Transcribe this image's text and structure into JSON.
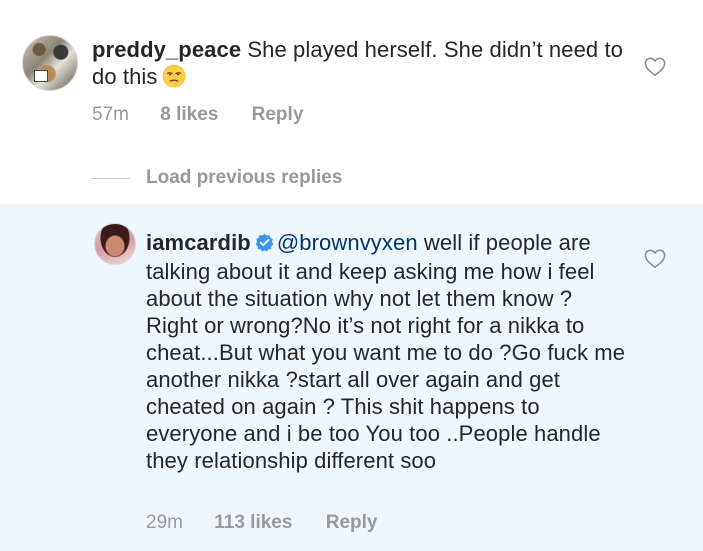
{
  "comments": [
    {
      "username": "preddy_peace",
      "text": " She played herself.  She didn’t need to do this",
      "emoji": "unamused-face",
      "time": "57m",
      "likes": "8 likes",
      "reply": "Reply"
    }
  ],
  "load_previous": "Load previous replies",
  "reply": {
    "username": "iamcardib",
    "verified_icon": "verified-badge-icon",
    "mention": "@brownvyxen",
    "text": " well if people are talking about it and keep asking me how i feel about the situation why not let them know ? Right or wrong?No it’s not right for a nikka to cheat...But what you want me to do ?Go fuck me another nikka ?start all over again and get cheated on again ? This shit happens to everyone and i be too You too ..People handle they relationship different soo",
    "time": "29m",
    "likes": "113 likes",
    "reply": "Reply"
  },
  "colors": {
    "text": "#262626",
    "meta": "#999999",
    "mention": "#003569",
    "verified": "#3897f0",
    "reply_highlight": "#eff7fe"
  }
}
